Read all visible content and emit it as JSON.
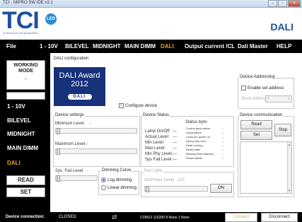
{
  "window": {
    "title": "TCI - MIPRO SW IDE v3.1",
    "controls": [
      "–",
      "▫",
      "×"
    ]
  },
  "banner": {
    "logo": "TCI",
    "led": "LED",
    "tagline": "professional led applications",
    "product": "DALI"
  },
  "menu": {
    "items": [
      "File",
      "1 - 10V",
      "BILEVEL",
      "MIDNIGHT",
      "MAIN DIMM",
      "DALI",
      "Output current /CL",
      "Dali Master",
      "HELP"
    ],
    "active": "DALI",
    "active_color": "#e8a623"
  },
  "sidebar": {
    "mode_label_1": "WORKING",
    "mode_label_2": "MODE",
    "mode_value": "-",
    "items": [
      "1 - 10V",
      "BILEVEL",
      "MIDNIGHT",
      "MAIN DIMM",
      "DALI"
    ],
    "read_label": "READ",
    "set_label": "SET"
  },
  "config": {
    "title": "DALI configuration",
    "award_line1": "DALI Award",
    "award_line2": "2012",
    "award_badge": "DALI",
    "configure_label": "Configure device",
    "configure_checked": true
  },
  "settings": {
    "title": "Device settings",
    "min_label": "Minimum Level:",
    "min_value": "-",
    "max_label": "Maximum Level:",
    "max_value": "-",
    "sys_fail_label": "Sys. Fail Level:",
    "sys_fail_value": "-"
  },
  "dimming": {
    "title": "Dimming Curve",
    "options": [
      "Log dimming",
      "Linear dimming"
    ],
    "selected": "Log dimming"
  },
  "device_status": {
    "title": "Device Status",
    "rows": [
      {
        "label": "Lamp On/Off:",
        "value": "---"
      },
      {
        "label": "Actual Level:",
        "value": "---"
      },
      {
        "label": "Min Level:",
        "value": "---"
      },
      {
        "label": "Max Level:",
        "value": "---"
      },
      {
        "label": "Min Phy Level:",
        "value": "---"
      },
      {
        "label": "Sys Fail Level:",
        "value": "---"
      }
    ],
    "status_byte_title": "Status byte:",
    "status_byte": [
      {
        "label": "Control gear status",
        "value": "--"
      },
      {
        "label": "Lamp failure",
        "value": "--"
      },
      {
        "label": "Lamp arc power on",
        "value": "--"
      },
      {
        "label": "Query limit error",
        "value": "--"
      },
      {
        "label": "Fade running",
        "value": "--"
      },
      {
        "label": "Reset state",
        "value": "--"
      },
      {
        "label": "Missing short address",
        "value": "--"
      },
      {
        "label": "Power failure",
        "value": "--"
      }
    ]
  },
  "test_light": {
    "title": "Test Light",
    "arc_label": "ArcPower Level",
    "arc_value": "127",
    "on_label": "ON"
  },
  "addressing": {
    "title": "Device Addressing",
    "enable_label": "Enable set address",
    "short_label": "Short Address",
    "short_value": "0"
  },
  "communication": {
    "title": "Device communication",
    "read_label": "Read",
    "set_label": "Set",
    "stop_label": "Stop"
  },
  "statusbar": {
    "connection_label": "Device connection:",
    "connection_value": "CLOSED",
    "port_info": "COM12 115200 8 None 1 None",
    "connect_label": "Connect",
    "disconnect_label": "Disconnect"
  }
}
